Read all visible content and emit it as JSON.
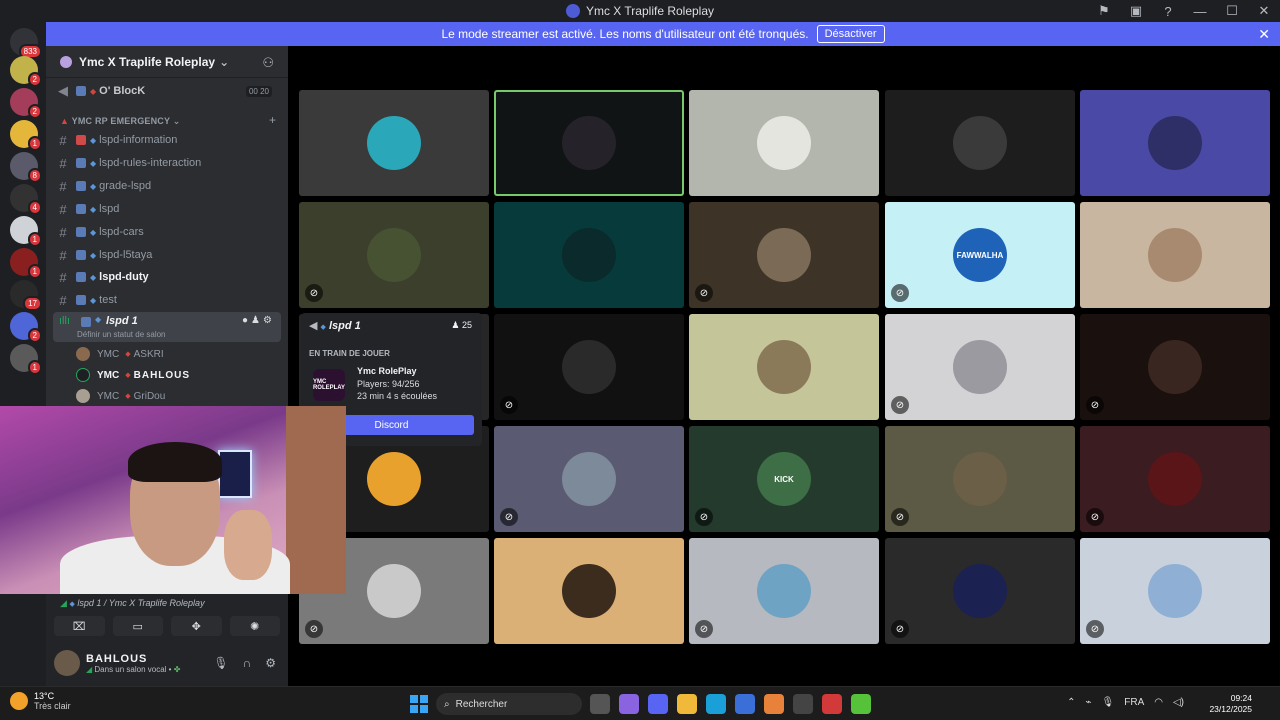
{
  "window": {
    "title": "Ymc X Traplife Roleplay"
  },
  "banner": {
    "text": "Le mode streamer est activé. Les noms d'utilisateur ont été tronqués.",
    "button": "Désactiver"
  },
  "guilds": {
    "mention_count": "833",
    "badges": [
      "2",
      "2",
      "1",
      "8",
      "4",
      "1",
      "1",
      "17",
      "2",
      "1"
    ]
  },
  "server": {
    "name": "Ymc X Traplife Roleplay"
  },
  "voice_top": {
    "name": "O' BlocK",
    "count_left": "00",
    "count_right": "20"
  },
  "category": {
    "name": "YMC RP EMERGENCY"
  },
  "channels": [
    {
      "name": "lspd-information"
    },
    {
      "name": "lspd-rules-interaction"
    },
    {
      "name": "grade-lspd"
    },
    {
      "name": "lspd"
    },
    {
      "name": "lspd-cars"
    },
    {
      "name": "lspd-l5taya"
    },
    {
      "name": "lspd-duty"
    },
    {
      "name": "test"
    }
  ],
  "active_voice": {
    "name": "lspd 1",
    "status_placeholder": "Définir un statut de salon"
  },
  "members": [
    {
      "tag": "YMC",
      "name": "ASKRI"
    },
    {
      "tag": "YMC",
      "name": "BAHLOUS"
    },
    {
      "tag": "YMC",
      "name": "GriDou"
    }
  ],
  "popup": {
    "channel": "lspd 1",
    "count": "25",
    "section": "EN TRAIN DE JOUER",
    "game_logo": "YMC ROLEPLAY",
    "game": "Ymc RolePlay",
    "players": "Players: 94/256",
    "elapsed": "23 min 4 s écoulées",
    "button": "Discord"
  },
  "voice_panel": {
    "location": "lspd 1 / Ymc X Traplife Roleplay"
  },
  "user": {
    "name": "BAHLOUS",
    "status": "Dans un salon vocal •"
  },
  "tiles": [
    {
      "bg": "#3a3a3a",
      "pic": "#2aa7b8",
      "muted": false
    },
    {
      "bg": "#101414",
      "pic": "#25222a",
      "muted": false,
      "border": "#77c96b"
    },
    {
      "bg": "#b3b6ad",
      "pic": "#e5e5e0",
      "muted": false
    },
    {
      "bg": "#1d1d1d",
      "pic": "#3a3a3a",
      "muted": false
    },
    {
      "bg": "#4a4aa6",
      "pic": "#2d2f66",
      "muted": false
    },
    {
      "bg": "#3b3f2b",
      "pic": "#465232",
      "muted": true
    },
    {
      "bg": "#073a3a",
      "pic": "#0b2a2c",
      "muted": false
    },
    {
      "bg": "#3d3427",
      "pic": "#7b6a55",
      "muted": true
    },
    {
      "bg": "#c4f0f6",
      "pic": "#1f63b9",
      "muted": true,
      "label": "FAWWALHA"
    },
    {
      "bg": "#c9b6a0",
      "pic": "#a88a70",
      "muted": false
    },
    {
      "bg": "#262626",
      "pic": "#444",
      "muted": false
    },
    {
      "bg": "#111111",
      "pic": "#2a2a2a",
      "muted": true
    },
    {
      "bg": "#c4c598",
      "pic": "#8b7a5a",
      "muted": false
    },
    {
      "bg": "#d3d3d5",
      "pic": "#9a9aa0",
      "muted": true
    },
    {
      "bg": "#1a100e",
      "pic": "#3a2620",
      "muted": true
    },
    {
      "bg": "#1e1e1e",
      "pic": "#e9a12d",
      "muted": false
    },
    {
      "bg": "#5a5a72",
      "pic": "#7d8a9a",
      "muted": true
    },
    {
      "bg": "#233a2d",
      "pic": "#3d6e45",
      "muted": true,
      "label": "KICK"
    },
    {
      "bg": "#5c5a44",
      "pic": "#6b5f48",
      "muted": true
    },
    {
      "bg": "#3b1c20",
      "pic": "#5a1518",
      "muted": true
    },
    {
      "bg": "#7a7a7a",
      "pic": "#c9c9c9",
      "muted": true
    },
    {
      "bg": "#dbb076",
      "pic": "#3c2c1e",
      "muted": false
    },
    {
      "bg": "#b6bac0",
      "pic": "#6fa3c4",
      "muted": true
    },
    {
      "bg": "#2a2a2a",
      "pic": "#1b2150",
      "muted": true
    },
    {
      "bg": "#c9d2dc",
      "pic": "#8fb0d4",
      "muted": true
    }
  ],
  "taskbar": {
    "temp": "13°C",
    "weather": "Très clair",
    "search": "Rechercher",
    "lang": "FRA",
    "time": "09:24",
    "date": "23/12/2025"
  }
}
